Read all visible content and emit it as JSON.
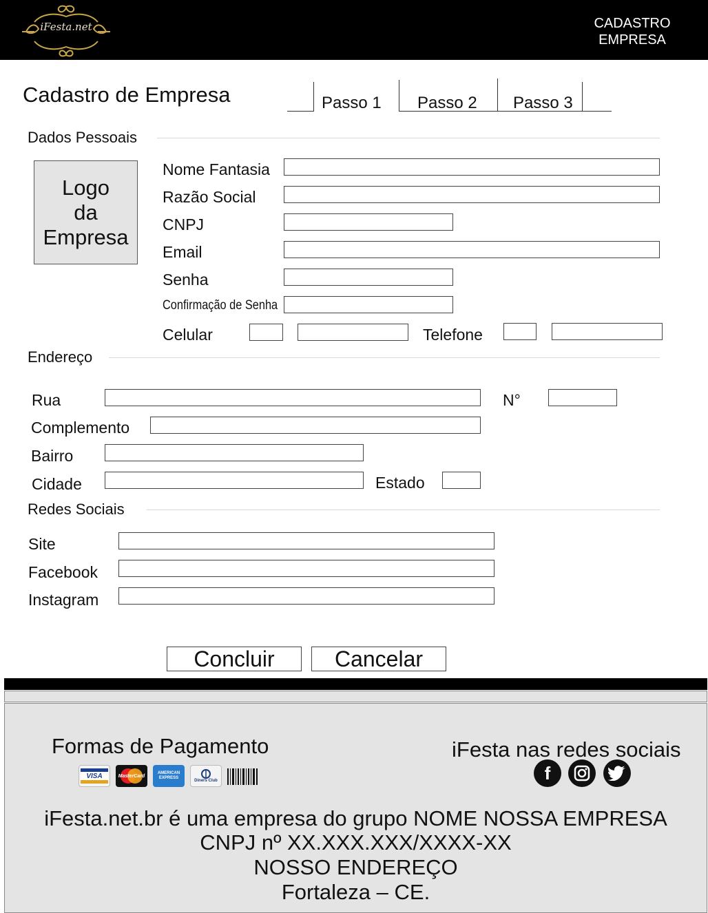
{
  "header": {
    "brand": "iFesta.net",
    "title_line1": "CADASTRO",
    "title_line2": "EMPRESA"
  },
  "page": {
    "title": "Cadastro de Empresa",
    "steps": [
      "Passo 1",
      "Passo 2",
      "Passo 3"
    ]
  },
  "dados_pessoais": {
    "section": "Dados Pessoais",
    "logo_line1": "Logo",
    "logo_line2": "da",
    "logo_line3": "Empresa",
    "nome_fantasia": "Nome Fantasia",
    "razao_social": "Razão Social",
    "cnpj": "CNPJ",
    "email": "Email",
    "senha": "Senha",
    "confirmacao_senha": "Confirmação de Senha",
    "celular": "Celular",
    "telefone": "Telefone"
  },
  "endereco": {
    "section": "Endereço",
    "rua": "Rua",
    "numero": "N°",
    "complemento": "Complemento",
    "bairro": "Bairro",
    "cidade": "Cidade",
    "estado": "Estado"
  },
  "redes_sociais": {
    "section": "Redes Sociais",
    "site": "Site",
    "facebook": "Facebook",
    "instagram": "Instagram"
  },
  "actions": {
    "concluir": "Concluir",
    "cancelar": "Cancelar"
  },
  "footer": {
    "payment_title": "Formas de Pagamento",
    "payment_methods": [
      {
        "name": "visa-card-icon",
        "label": "VISA"
      },
      {
        "name": "mastercard-card-icon",
        "label": "MasterCard"
      },
      {
        "name": "amex-card-icon",
        "label": "AMERICAN EXPRESS"
      },
      {
        "name": "diners-card-icon",
        "label": "Diners Club"
      },
      {
        "name": "boleto-barcode-icon",
        "label": ""
      }
    ],
    "social_title": "iFesta nas redes sociais",
    "social_icons": [
      "facebook-icon",
      "instagram-icon",
      "twitter-icon"
    ],
    "company_line1": "iFesta.net.br é uma empresa do grupo NOME NOSSA EMPRESA",
    "company_line2": "CNPJ nº XX.XXX.XXX/XXXX-XX",
    "company_line3": "NOSSO ENDEREÇO",
    "company_line4": "Fortaleza – CE."
  },
  "colors": {
    "header_bg": "#000000",
    "footer_bg": "#e4e4e4",
    "logo_box_bg": "#e4e4e4",
    "brand_gold": "#c9a64a"
  }
}
